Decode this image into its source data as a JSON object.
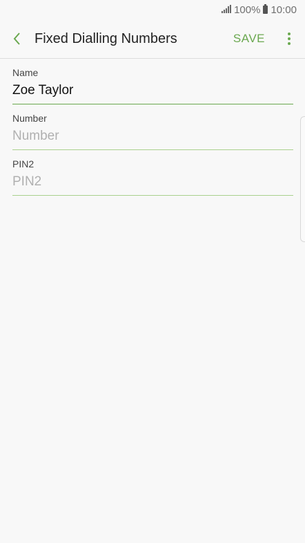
{
  "status_bar": {
    "battery": "100%",
    "time": "10:00"
  },
  "header": {
    "title": "Fixed Dialling Numbers",
    "save_label": "SAVE"
  },
  "form": {
    "name": {
      "label": "Name",
      "value": "Zoe Taylor",
      "placeholder": ""
    },
    "number": {
      "label": "Number",
      "value": "",
      "placeholder": "Number"
    },
    "pin2": {
      "label": "PIN2",
      "value": "",
      "placeholder": "PIN2"
    }
  },
  "colors": {
    "accent": "#6aa84f",
    "background": "#f8f8f8"
  },
  "icons": {
    "back": "back-arrow-icon",
    "more": "more-vertical-icon",
    "signal": "signal-icon",
    "battery": "battery-icon"
  }
}
